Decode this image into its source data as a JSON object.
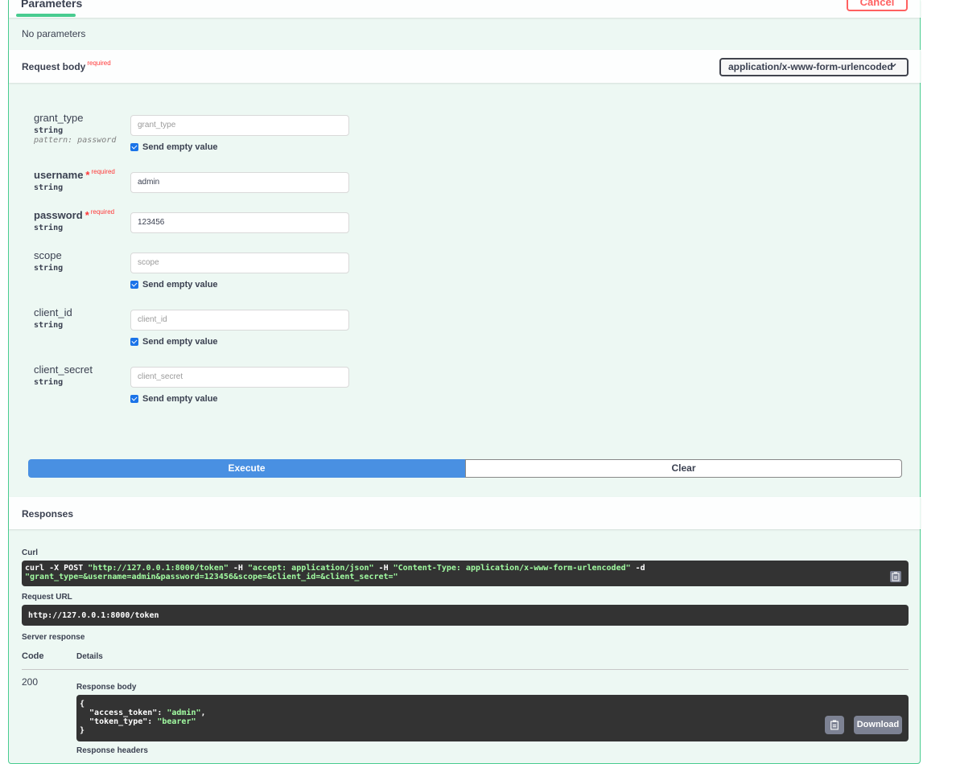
{
  "parameters": {
    "tab_label": "Parameters",
    "cancel_label": "Cancel",
    "no_params_text": "No parameters"
  },
  "request_body": {
    "title": "Request body",
    "required_label": "required",
    "content_type": "application/x-www-form-urlencoded",
    "fields": {
      "grant_type": {
        "name": "grant_type",
        "type": "string",
        "pattern": "pattern: password",
        "placeholder": "grant_type",
        "send_empty_label": "Send empty value"
      },
      "username": {
        "name": "username",
        "star": "*",
        "required": "required",
        "type": "string",
        "value": "admin"
      },
      "password": {
        "name": "password",
        "star": "*",
        "required": "required",
        "type": "string",
        "value": "123456"
      },
      "scope": {
        "name": "scope",
        "type": "string",
        "placeholder": "scope",
        "send_empty_label": "Send empty value"
      },
      "client_id": {
        "name": "client_id",
        "type": "string",
        "placeholder": "client_id",
        "send_empty_label": "Send empty value"
      },
      "client_secret": {
        "name": "client_secret",
        "type": "string",
        "placeholder": "client_secret",
        "send_empty_label": "Send empty value"
      }
    },
    "execute_label": "Execute",
    "clear_label": "Clear"
  },
  "responses": {
    "title": "Responses",
    "curl_label": "Curl",
    "curl": {
      "cmd1": "curl -X POST ",
      "url": "\"http://127.0.0.1:8000/token\"",
      "h1": " -H  ",
      "accept": "\"accept: application/json\"",
      "h2": " -H  ",
      "ctype": "\"Content-Type: application/x-www-form-urlencoded\"",
      "d": " -d",
      "data": "\"grant_type=&username=admin&password=123456&scope=&client_id=&client_secret=\""
    },
    "request_url_label": "Request URL",
    "request_url": "http://127.0.0.1:8000/token",
    "server_response_label": "Server response",
    "code_header": "Code",
    "details_header": "Details",
    "code": "200",
    "response_body_label": "Response body",
    "body": {
      "open": "{",
      "k1": "  \"access_token\": ",
      "v1": "\"admin\"",
      "k2": "  \"token_type\": ",
      "v2": "\"bearer\"",
      "close": "}"
    },
    "download_label": "Download",
    "next_label": "Response headers"
  }
}
